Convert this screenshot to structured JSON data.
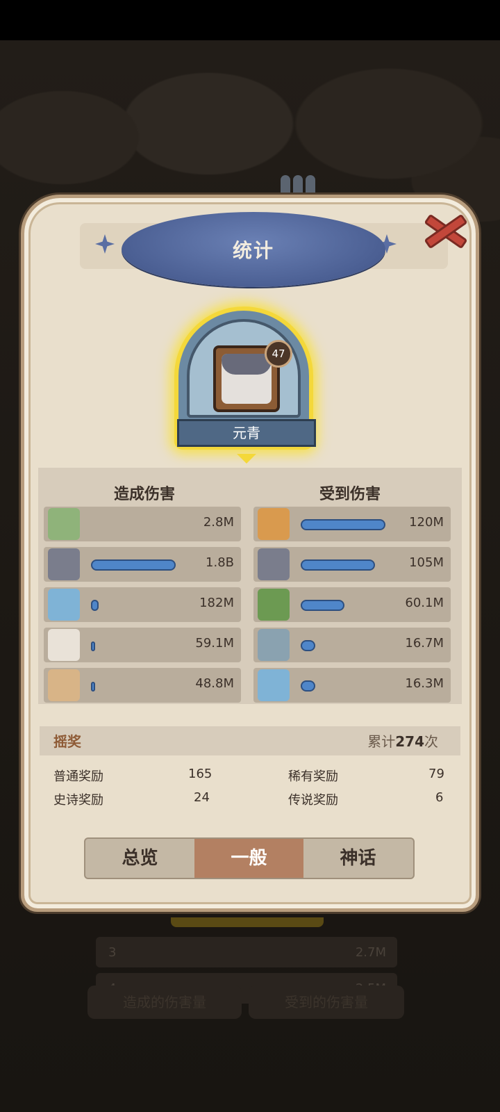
{
  "background": {
    "rows": [
      {
        "rank": "3",
        "value": "2.7M"
      },
      {
        "rank": "4",
        "value": "2.5M"
      }
    ],
    "buttons": [
      "造成的伤害量",
      "受到的伤害量"
    ]
  },
  "dialog": {
    "title": "统计",
    "close_icon": "close-x-icon",
    "hero": {
      "name": "元青",
      "level": "47"
    }
  },
  "damage_dealt": {
    "title": "造成伤害",
    "rows": [
      {
        "avatar": "green-hat-hero-icon",
        "value": "2.8M",
        "fill": 0.0
      },
      {
        "avatar": "gray-cat-hero-icon",
        "value": "1.8B",
        "fill": 1.0
      },
      {
        "avatar": "blue-swirl-hero-icon",
        "value": "182M",
        "fill": 0.06
      },
      {
        "avatar": "white-cat-hero-icon",
        "value": "59.1M",
        "fill": 0.02
      },
      {
        "avatar": "tan-cat-hero-icon",
        "value": "48.8M",
        "fill": 0.02
      }
    ]
  },
  "damage_taken": {
    "title": "受到伤害",
    "rows": [
      {
        "avatar": "orange-cat-hero-icon",
        "value": "120M",
        "fill": 1.0
      },
      {
        "avatar": "gray-cat-hero-icon",
        "value": "105M",
        "fill": 0.875
      },
      {
        "avatar": "green-frog-hero-icon",
        "value": "60.1M",
        "fill": 0.5
      },
      {
        "avatar": "robot-hero-icon",
        "value": "16.7M",
        "fill": 0.14
      },
      {
        "avatar": "blue-swirl-hero-icon",
        "value": "16.3M",
        "fill": 0.14
      }
    ]
  },
  "lottery": {
    "title": "摇奖",
    "total_prefix": "累计",
    "total_count": "274",
    "total_suffix": "次",
    "rewards": [
      {
        "label": "普通奖励",
        "value": "165"
      },
      {
        "label": "稀有奖励",
        "value": "79"
      },
      {
        "label": "史诗奖励",
        "value": "24"
      },
      {
        "label": "传说奖励",
        "value": "6"
      }
    ]
  },
  "tabs": [
    {
      "label": "总览",
      "active": false
    },
    {
      "label": "一般",
      "active": true
    },
    {
      "label": "神话",
      "active": false
    }
  ],
  "colors": {
    "accent": "#b38062",
    "bar": "#4f86c9",
    "highlight": "#f4d83a"
  }
}
